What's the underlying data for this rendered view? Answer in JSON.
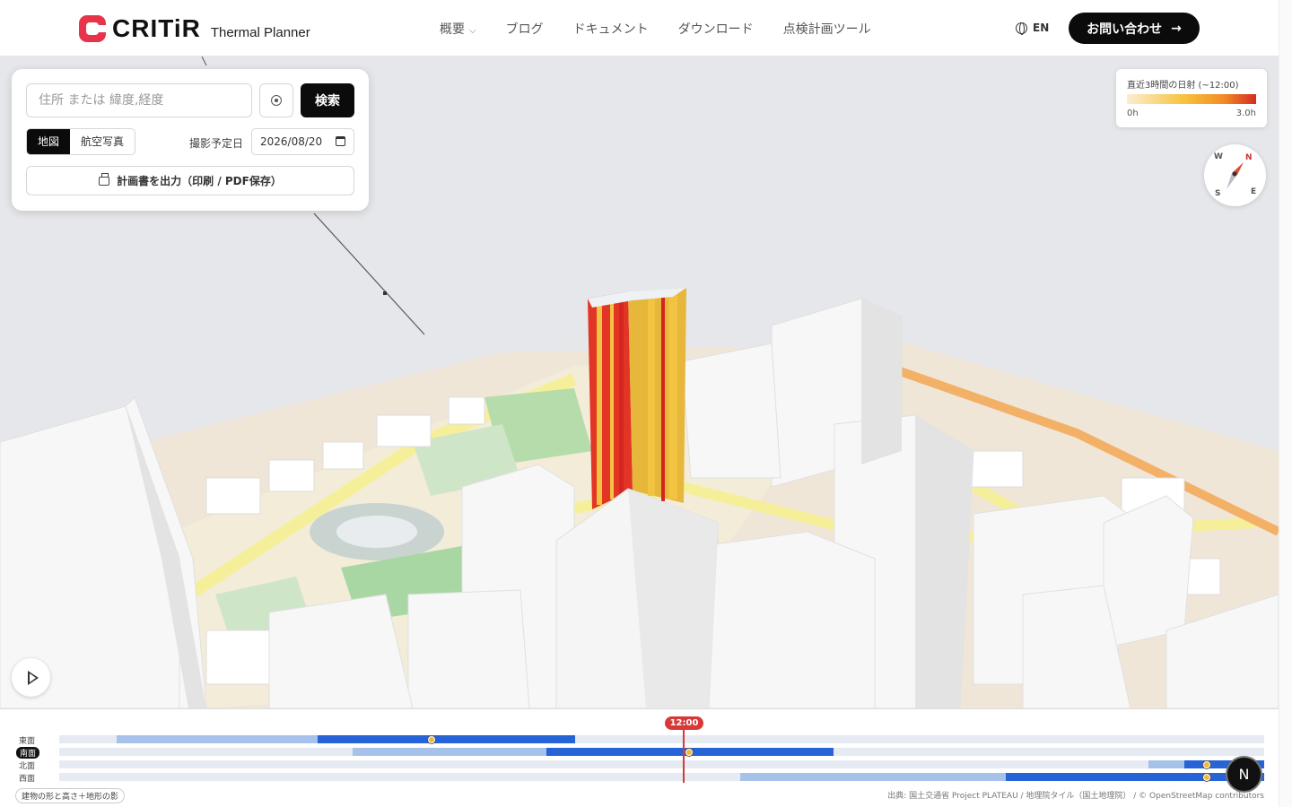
{
  "header": {
    "brand": "CRITiR",
    "product": "Thermal Planner",
    "nav": [
      {
        "label": "概要",
        "has_dropdown": true
      },
      {
        "label": "ブログ"
      },
      {
        "label": "ドキュメント"
      },
      {
        "label": "ダウンロード"
      },
      {
        "label": "点検計画ツール"
      }
    ],
    "language": "EN",
    "contact_label": "お問い合わせ",
    "contact_arrow": "→"
  },
  "search_panel": {
    "placeholder": "住所 または 緯度,経度",
    "search_label": "検索",
    "map_modes": [
      {
        "label": "地図",
        "active": true
      },
      {
        "label": "航空写真",
        "active": false
      }
    ],
    "date_label": "撮影予定日",
    "date_value": "2026/08/20",
    "export_label": "計画書を出力（印刷 / PDF保存）"
  },
  "legend": {
    "title": "直近3時間の日射 (~12:00)",
    "min_label": "0h",
    "max_label": "3.0h",
    "colors": [
      "#fbeed0",
      "#f7c23b",
      "#f28b26",
      "#d42b24"
    ]
  },
  "compass": {
    "n": "N",
    "e": "E",
    "s": "S",
    "w": "W"
  },
  "timeline": {
    "current_time": "12:00",
    "rows": [
      {
        "label": "東面",
        "selected": false
      },
      {
        "label": "南面",
        "selected": true
      },
      {
        "label": "北面",
        "selected": false
      },
      {
        "label": "西面",
        "selected": false
      }
    ],
    "source_chip": "建物の形と高さ＋地形の影",
    "attribution": "出典: 国土交通省 Project PLATEAU / 地理院タイル（国土地理院） / © OpenStreetMap contributors",
    "n_button": "N"
  },
  "icons": {
    "locate": "crosshair-icon",
    "globe": "globe-icon",
    "printer": "printer-icon",
    "calendar": "calendar-icon",
    "play": "play-icon"
  }
}
